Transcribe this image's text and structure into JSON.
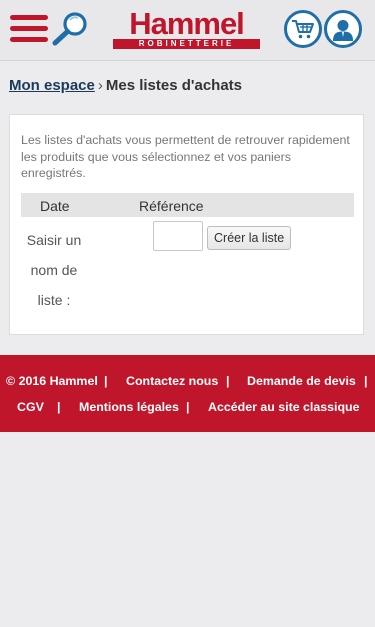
{
  "header": {
    "logo_text": "Hammel",
    "logo_subtext": "ROBINETTERIE",
    "menu_icon": "hamburger-menu-icon",
    "search_icon": "magnifier-icon",
    "cart_icon": "shopping-cart-icon",
    "account_icon": "user-account-icon",
    "accent_color": "#c0162b",
    "icon_color": "#1f6ea8"
  },
  "breadcrumb": {
    "parent": "Mon espace",
    "separator": "›",
    "current": "Mes listes d'achats"
  },
  "shopping_lists": {
    "intro": "Les listes d'achats vous permettent de retrouver rapidement les produits que vous sélectionnez et vos paniers enregistrés.",
    "columns": [
      "Date",
      "Référence"
    ],
    "input_label": "Saisir un nom de liste :",
    "input_value": "",
    "create_button": "Créer la liste"
  },
  "footer": {
    "copyright": "© 2016 Hammel",
    "links": [
      "Contactez nous",
      "Demande de devis",
      "CGV",
      "Mentions légales",
      "Accéder au site classique"
    ],
    "separator": "|"
  }
}
